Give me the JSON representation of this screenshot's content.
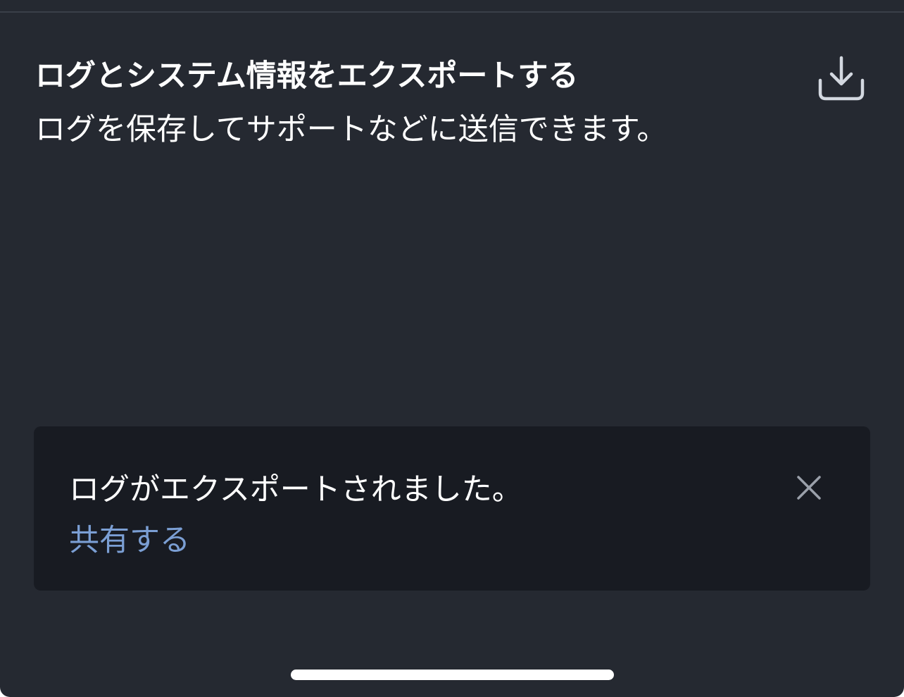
{
  "export": {
    "title": "ログとシステム情報をエクスポートする",
    "description": "ログを保存してサポートなどに送信できます。",
    "icon": "download-icon"
  },
  "toast": {
    "message": "ログがエクスポートされました。",
    "share_label": "共有する",
    "close_icon": "close-icon"
  },
  "colors": {
    "background": "#252931",
    "toast_background": "#181b22",
    "text": "#ffffff",
    "link": "#7b9fd4",
    "icon": "#d3d8e0",
    "close_icon": "#9aa0aa",
    "divider": "#3a3f48"
  }
}
